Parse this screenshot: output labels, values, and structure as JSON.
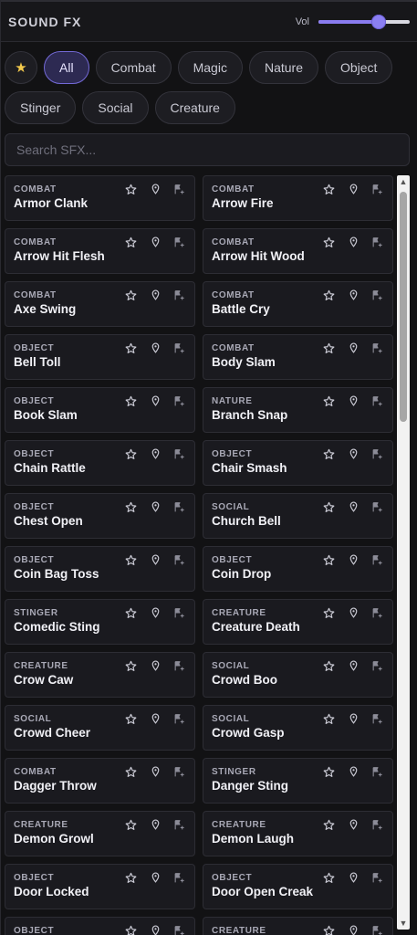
{
  "header": {
    "title": "SOUND FX",
    "volume_label": "Vol",
    "volume_value": 0.66
  },
  "filters": {
    "favorites_icon": "star-icon",
    "chips": [
      {
        "label": "All",
        "active": true
      },
      {
        "label": "Combat",
        "active": false
      },
      {
        "label": "Magic",
        "active": false
      },
      {
        "label": "Nature",
        "active": false
      },
      {
        "label": "Object",
        "active": false
      },
      {
        "label": "Stinger",
        "active": false
      },
      {
        "label": "Social",
        "active": false
      },
      {
        "label": "Creature",
        "active": false
      }
    ]
  },
  "search": {
    "placeholder": "Search SFX...",
    "value": ""
  },
  "card_actions": [
    "star-icon",
    "pin-icon",
    "add-to-playlist-icon"
  ],
  "sounds": [
    {
      "category": "COMBAT",
      "name": "Armor Clank"
    },
    {
      "category": "COMBAT",
      "name": "Arrow Fire"
    },
    {
      "category": "COMBAT",
      "name": "Arrow Hit Flesh"
    },
    {
      "category": "COMBAT",
      "name": "Arrow Hit Wood"
    },
    {
      "category": "COMBAT",
      "name": "Axe Swing"
    },
    {
      "category": "COMBAT",
      "name": "Battle Cry"
    },
    {
      "category": "OBJECT",
      "name": "Bell Toll"
    },
    {
      "category": "COMBAT",
      "name": "Body Slam"
    },
    {
      "category": "OBJECT",
      "name": "Book Slam"
    },
    {
      "category": "NATURE",
      "name": "Branch Snap"
    },
    {
      "category": "OBJECT",
      "name": "Chain Rattle"
    },
    {
      "category": "OBJECT",
      "name": "Chair Smash"
    },
    {
      "category": "OBJECT",
      "name": "Chest Open"
    },
    {
      "category": "SOCIAL",
      "name": "Church Bell"
    },
    {
      "category": "OBJECT",
      "name": "Coin Bag Toss"
    },
    {
      "category": "OBJECT",
      "name": "Coin Drop"
    },
    {
      "category": "STINGER",
      "name": "Comedic Sting"
    },
    {
      "category": "CREATURE",
      "name": "Creature Death"
    },
    {
      "category": "CREATURE",
      "name": "Crow Caw"
    },
    {
      "category": "SOCIAL",
      "name": "Crowd Boo"
    },
    {
      "category": "SOCIAL",
      "name": "Crowd Cheer"
    },
    {
      "category": "SOCIAL",
      "name": "Crowd Gasp"
    },
    {
      "category": "COMBAT",
      "name": "Dagger Throw"
    },
    {
      "category": "STINGER",
      "name": "Danger Sting"
    },
    {
      "category": "CREATURE",
      "name": "Demon Growl"
    },
    {
      "category": "CREATURE",
      "name": "Demon Laugh"
    },
    {
      "category": "OBJECT",
      "name": "Door Locked"
    },
    {
      "category": "OBJECT",
      "name": "Door Open Creak"
    },
    {
      "category": "OBJECT",
      "name": ""
    },
    {
      "category": "CREATURE",
      "name": ""
    }
  ],
  "scrollbar": {
    "up_icon": "scroll-up-arrow-icon",
    "down_icon": "scroll-down-arrow-icon",
    "position": 0.0
  },
  "colors": {
    "accent": "#8a7cf0",
    "favorite": "#f2c94c",
    "background": "#121214",
    "card": "#1a1a1f"
  }
}
